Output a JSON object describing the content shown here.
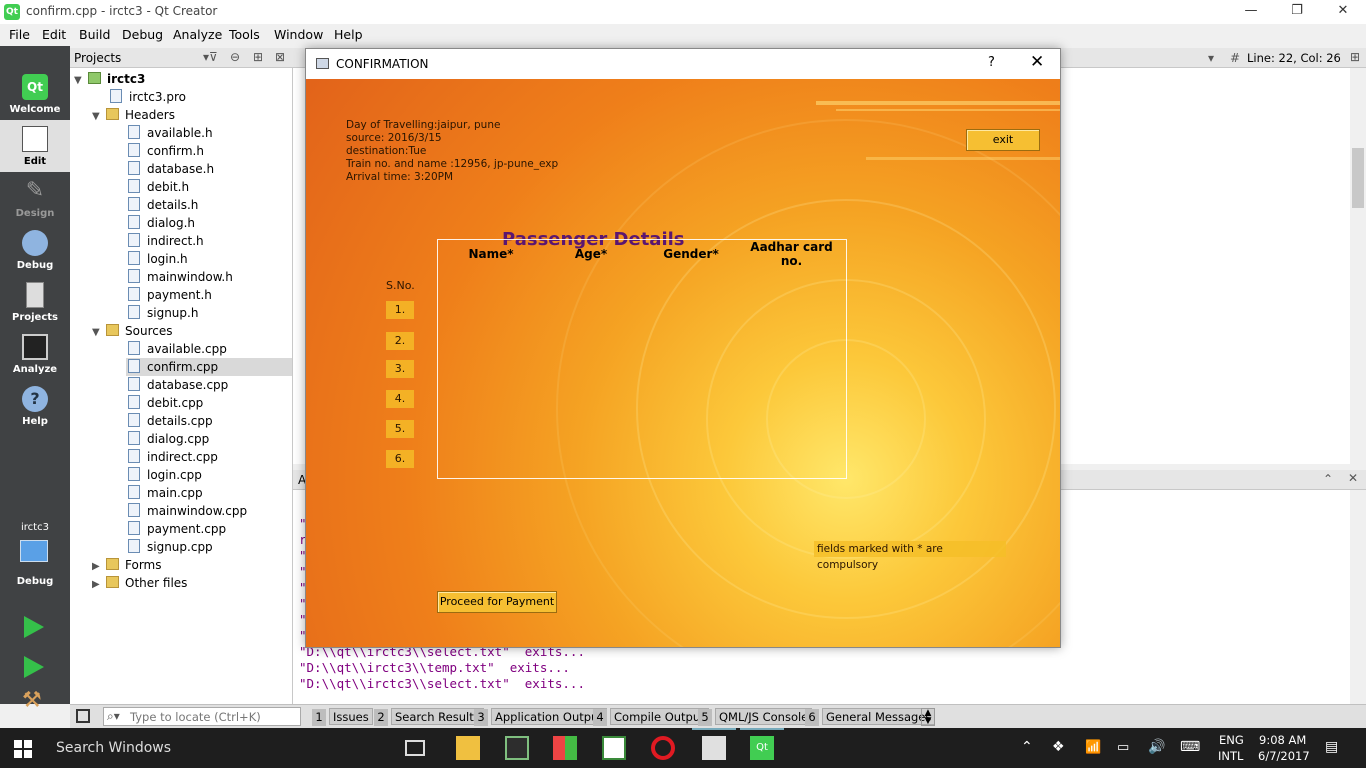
{
  "window": {
    "title": "confirm.cpp - irctc3 - Qt Creator"
  },
  "menu": [
    "File",
    "Edit",
    "Build",
    "Debug",
    "Analyze",
    "Tools",
    "Window",
    "Help"
  ],
  "modes": [
    "Welcome",
    "Edit",
    "Design",
    "Debug",
    "Projects",
    "Analyze",
    "Help"
  ],
  "target": {
    "project": "irctc3",
    "mode": "Debug"
  },
  "projects": {
    "header": "Projects",
    "root": "irctc3",
    "pro": "irctc3.pro",
    "headers_label": "Headers",
    "headers": [
      "available.h",
      "confirm.h",
      "database.h",
      "debit.h",
      "details.h",
      "dialog.h",
      "indirect.h",
      "login.h",
      "mainwindow.h",
      "payment.h",
      "signup.h"
    ],
    "sources_label": "Sources",
    "sources": [
      "available.cpp",
      "confirm.cpp",
      "database.cpp",
      "debit.cpp",
      "details.cpp",
      "dialog.cpp",
      "indirect.cpp",
      "login.cpp",
      "main.cpp",
      "mainwindow.cpp",
      "payment.cpp",
      "signup.cpp"
    ],
    "forms": "Forms",
    "other": "Other files"
  },
  "editor": {
    "position": "Line: 22, Col: 26",
    "hash": "#"
  },
  "output": {
    "lines": [
      "\"D:\\\\qt\\\\irctc3\\\\select.txt\"  exits...",
      "\"D:\\\\qt\\\\irctc3\\\\temp.txt\"  exits...",
      "\"D:\\\\qt\\\\irctc3\\\\select.txt\"  exits..."
    ],
    "frag": [
      "\"",
      "r",
      "\"",
      "\"",
      "\"",
      "\"",
      "\"",
      "\""
    ],
    "pane_letter": "A"
  },
  "locator": {
    "placeholder": "Type to locate (Ctrl+K)"
  },
  "output_tabs": [
    {
      "num": "1",
      "label": "Issues"
    },
    {
      "num": "2",
      "label": "Search Results"
    },
    {
      "num": "3",
      "label": "Application Output"
    },
    {
      "num": "4",
      "label": "Compile Output"
    },
    {
      "num": "5",
      "label": "QML/JS Console"
    },
    {
      "num": "6",
      "label": "General Messages"
    }
  ],
  "dialog": {
    "title": "CONFIRMATION",
    "help": "?",
    "close": "✕",
    "exit_label": "exit",
    "info": [
      "Day of Travelling:jaipur, pune",
      "source: 2016/3/15",
      "destination:Tue",
      "Train no. and name :12956, jp-pune_exp",
      "Arrival time: 3:20PM"
    ],
    "heading": "Passenger Details",
    "sno_label": "S.No.",
    "row_numbers": [
      "1.",
      "2.",
      "3.",
      "4.",
      "5.",
      "6."
    ],
    "columns": [
      "Name*",
      "Age*",
      "Gender*",
      "Aadhar card no."
    ],
    "note": "fields marked with * are compulsory",
    "proceed_label": "Proceed for Payment"
  },
  "taskbar": {
    "search": "Search Windows",
    "lang1": "ENG",
    "lang2": "INTL",
    "time": "9:08 AM",
    "date": "6/7/2017"
  }
}
